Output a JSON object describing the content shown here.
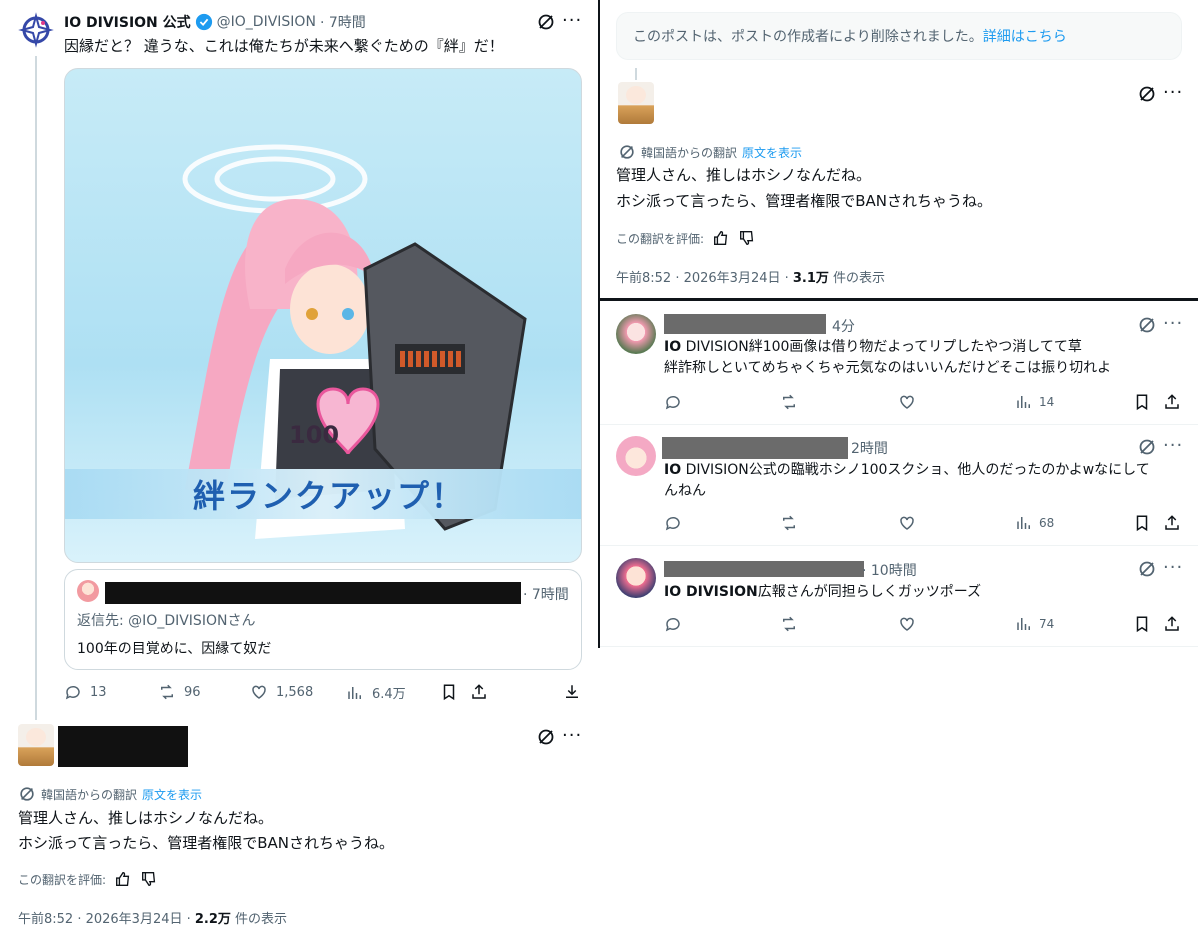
{
  "left_post": {
    "display_name": "IO DIVISION 公式",
    "handle": "@IO_DIVISION",
    "time": "· 7時間",
    "text": "因縁だと？ 違うな、これは俺たちが未来へ繋ぐための『絆』だ！",
    "image": {
      "heart_number": "100",
      "banner_text": "絆ランクアップ！"
    },
    "quote": {
      "time": "· 7時間",
      "reply_to": "返信先: @IO_DIVISIONさん",
      "text": "100年の目覚めに、因縁て奴だ"
    },
    "actions": {
      "reply_count": "13",
      "retweet_count": "96",
      "like_count": "1,568",
      "view_count": "6.4万"
    }
  },
  "left_reply": {
    "translation_label": "韓国語からの翻訳",
    "show_original": "原文を表示",
    "line1": "管理人さん、推しはホシノなんだね。",
    "line2": "ホシ派って言ったら、管理者権限でBANされちゃうね。",
    "rate_label": "この翻訳を評価:",
    "meta_time": "午前8:52 · 2026年3月24日 · ",
    "meta_views": "2.2万",
    "meta_views_suffix": " 件の表示"
  },
  "right_top": {
    "deleted_notice": "このポストは、ポストの作成者により削除されました。",
    "deleted_link": "詳細はこちら",
    "translation_label": "韓国語からの翻訳",
    "show_original": "原文を表示",
    "line1": "管理人さん、推しはホシノなんだね。",
    "line2": "ホシ派って言ったら、管理者権限でBANされちゃうね。",
    "rate_label": "この翻訳を評価:",
    "meta_time": "午前8:52 · 2026年3月24日 · ",
    "meta_views": "3.1万",
    "meta_views_suffix": " 件の表示"
  },
  "right_replies": [
    {
      "time": "4分",
      "bold": "IO",
      "line1": " DIVISION絆100画像は借り物だよってリプしたやつ消してて草",
      "line2": "絆詐称しといてめちゃくちゃ元気なのはいいんだけどそこは振り切れよ",
      "views": "14"
    },
    {
      "time": "2時間",
      "bold": "IO",
      "line1": " DIVISION公式の臨戦ホシノ100スクショ、他人のだったのかよwなにして",
      "line2": "んねん",
      "views": "68"
    },
    {
      "time": "· 10時間",
      "bold": "IO DIVISION",
      "line1": "広報さんが同担らしくガッツポーズ",
      "line2": "",
      "views": "74"
    }
  ],
  "colors": {
    "accent": "#1d9bf0",
    "text": "#0f1419",
    "muted": "#536471",
    "verified": "#1d9bf0"
  }
}
